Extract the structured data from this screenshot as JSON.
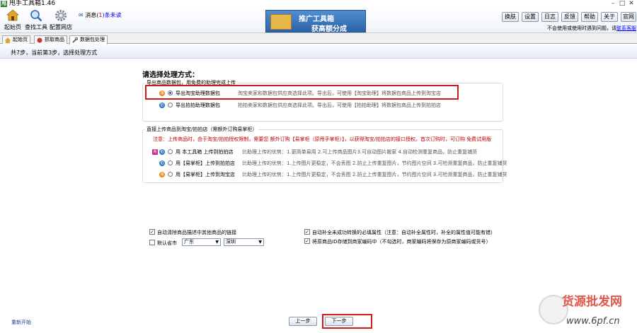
{
  "window": {
    "title": "甩手工具箱1.46",
    "app_icon": "甩"
  },
  "toolbar": {
    "items": [
      {
        "label": "起始页",
        "icon": "home-icon"
      },
      {
        "label": "查找工具",
        "icon": "search-icon"
      },
      {
        "label": "配置网店",
        "icon": "gear-icon"
      }
    ],
    "message_prefix": "消息(",
    "message_count": "1",
    "message_suffix": ")条未读",
    "banner_line1": "推广工具箱",
    "banner_line2": "获高额分成",
    "buttons": [
      "换肤",
      "设置",
      "日志",
      "反馈",
      "帮助",
      "关于",
      "官网"
    ],
    "notice_text": "不会使用或使用时遇到问题，请",
    "notice_link": "联系客服"
  },
  "tabs": [
    {
      "label": "起始页",
      "active": false
    },
    {
      "label": "抓取商品",
      "active": false
    },
    {
      "label": "数据包处理",
      "active": true
    }
  ],
  "step_text": "共7步，当前第3步，选择处理方式",
  "heading": "请选择处理方式：",
  "group1": {
    "legend": "导出商品数据包，用免费的助理完成上传",
    "options": [
      {
        "label": "导出淘宝助理数据包",
        "desc": "淘宝卖家和数据包供应商选择此项。导出后，可使用【淘宝助理】将数据包商品上传到淘宝店",
        "selected": true,
        "icon": "taobao-icon"
      },
      {
        "label": "导出拍拍助理数据包",
        "desc": "拍拍卖家和数据包供应商选择此项。导出后，可使用【拍拍助理】将数据包商品上传到拍拍店",
        "selected": false,
        "icon": "paipai-icon"
      }
    ]
  },
  "group2": {
    "legend": "直接上传商品到淘宝/拍拍店（需额外订购易掌柜）",
    "note_prefix": "注意：上传商品时，由于淘宝/拍拍授权限制，需要您",
    "note_link": "额外订购【易掌柜（原甩手掌柜）】",
    "note_middle": "，以获得淘宝/拍拍店的接口授权。首次订购时，可订购",
    "note_trial": "免费试用版",
    "options": [
      {
        "label": "用 本工具箱 上传到拍拍店",
        "desc": "比助理上传的优势：1.更简单易用 2.可上传商品图片3.可自动图片搬家 4.自动检测重复商品，防止重复铺货",
        "selected": false
      },
      {
        "label": "用【易掌柜】上传到拍拍店",
        "desc": "比助理上传的优势：1.上传图片更稳定，不会丢图 2.防止上传重复图片，节约图片空间 3.可检测重复商品，防止重复铺货",
        "selected": false
      },
      {
        "label": "用【易掌柜】上传到淘宝店",
        "desc": "比助理上传的优势：1.上传图片更稳定，不会丢图 2.防止上传重复图片，节约图片空间 3.可检测重复商品，防止重复铺货",
        "selected": false
      }
    ]
  },
  "options": {
    "remove_links_label": "自动清除商品描述中其他商品的链接",
    "remove_links_checked": true,
    "default_region_label": "默认省市",
    "default_region_checked": false,
    "province": "广东",
    "city": "深圳",
    "auto_fill_label": "自动补全未成功转换的必填属性（注意：自动补全属性时，补全的属性值可能有错）",
    "auto_fill_checked": true,
    "save_id_label": "将原商品ID存储到商家编码中（不勾选时，商家编码将保存为原商家编码或货号）",
    "save_id_checked": true
  },
  "footer": {
    "restart": "重新开始",
    "prev": "上一步",
    "next": "下一步"
  },
  "watermark": {
    "line1": "货源批发网",
    "line2": "www.6pf.cn"
  },
  "colors": {
    "highlight": "#d31a1a",
    "accent": "#1a56b0",
    "note_red": "#c00000"
  }
}
